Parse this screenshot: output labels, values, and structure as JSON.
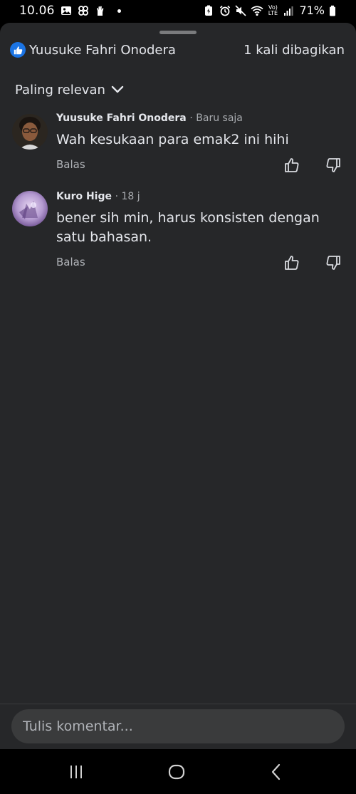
{
  "status_bar": {
    "time": "10.06",
    "battery": "71%",
    "icons": [
      "gallery-icon",
      "pinwheel-icon",
      "hand-icon",
      "notification-dot",
      "battery-saver-icon",
      "alarm-icon",
      "mute-icon",
      "wifi-icon",
      "volte-icon",
      "signal-icon",
      "battery-icon"
    ],
    "volte_label": "Vo) LTE"
  },
  "header": {
    "reaction_icon": "like-icon",
    "reaction_name": "Yuusuke Fahri Onodera",
    "share_count": "1 kali dibagikan"
  },
  "sort": {
    "label": "Paling relevan",
    "icon": "chevron-down-icon"
  },
  "comments": [
    {
      "author": "Yuusuke Fahri Onodera",
      "time": "· Baru saja",
      "text": "Wah kesukaan para emak2 ini hihi",
      "reply": "Balas"
    },
    {
      "author": "Kuro Hige",
      "time": "· 18 j",
      "text": "bener sih min, harus konsisten dengan satu bahasan.",
      "reply": "Balas"
    }
  ],
  "composer": {
    "placeholder": "Tulis komentar..."
  },
  "nav": {
    "icons": [
      "recent-apps-icon",
      "home-icon",
      "back-icon"
    ]
  },
  "colors": {
    "sheet_bg": "#262729",
    "accent_blue": "#1b74e4",
    "input_bg": "#3a3b3c"
  }
}
